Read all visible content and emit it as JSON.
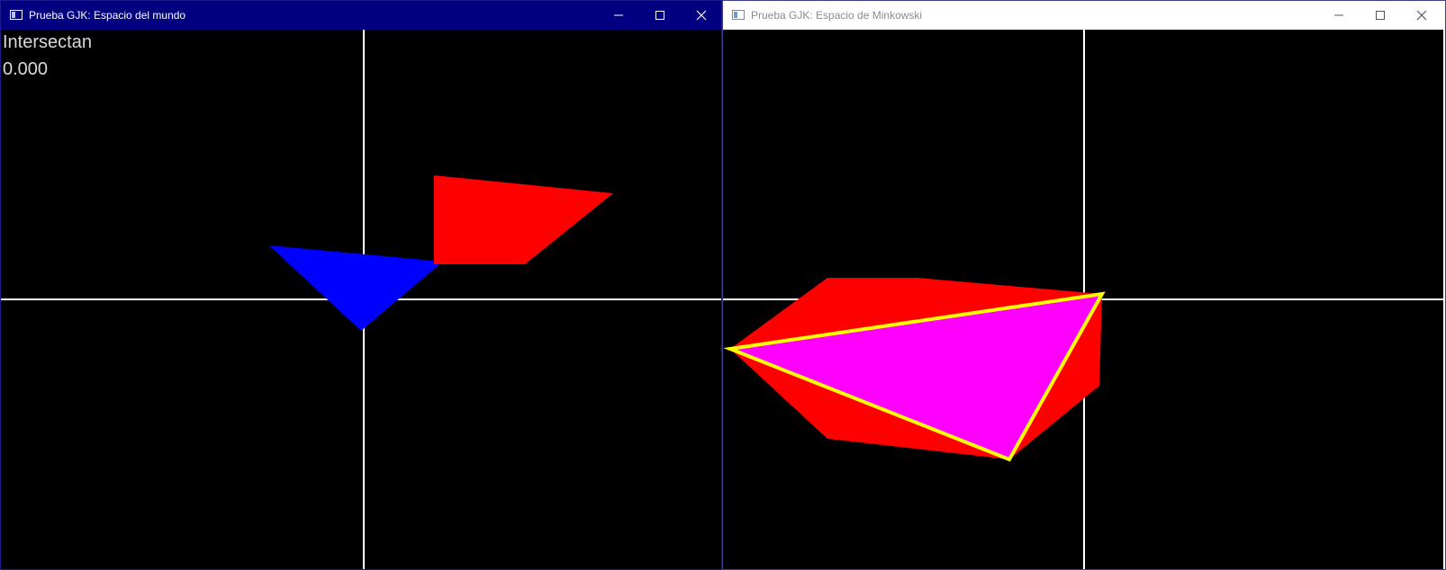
{
  "windows": {
    "world": {
      "title": "Prueba GJK: Espacio del mundo",
      "status": "Intersectan",
      "value": "0.000"
    },
    "minkowski": {
      "title": "Prueba GJK: Espacio de Minkowski"
    }
  },
  "title_buttons": [
    "minimize-icon",
    "maximize-icon",
    "close-icon"
  ],
  "colors": {
    "active_titlebar": "#000080",
    "inactive_titlebar": "#ffffff",
    "scene_background": "#000000",
    "axes": "#ffffff",
    "shape_a": "#0000ff",
    "shape_b": "#ff0000",
    "minkowski_difference": "#ff0000",
    "simplex_fill": "#ff00ff",
    "simplex_outline": "#ffff00"
  }
}
